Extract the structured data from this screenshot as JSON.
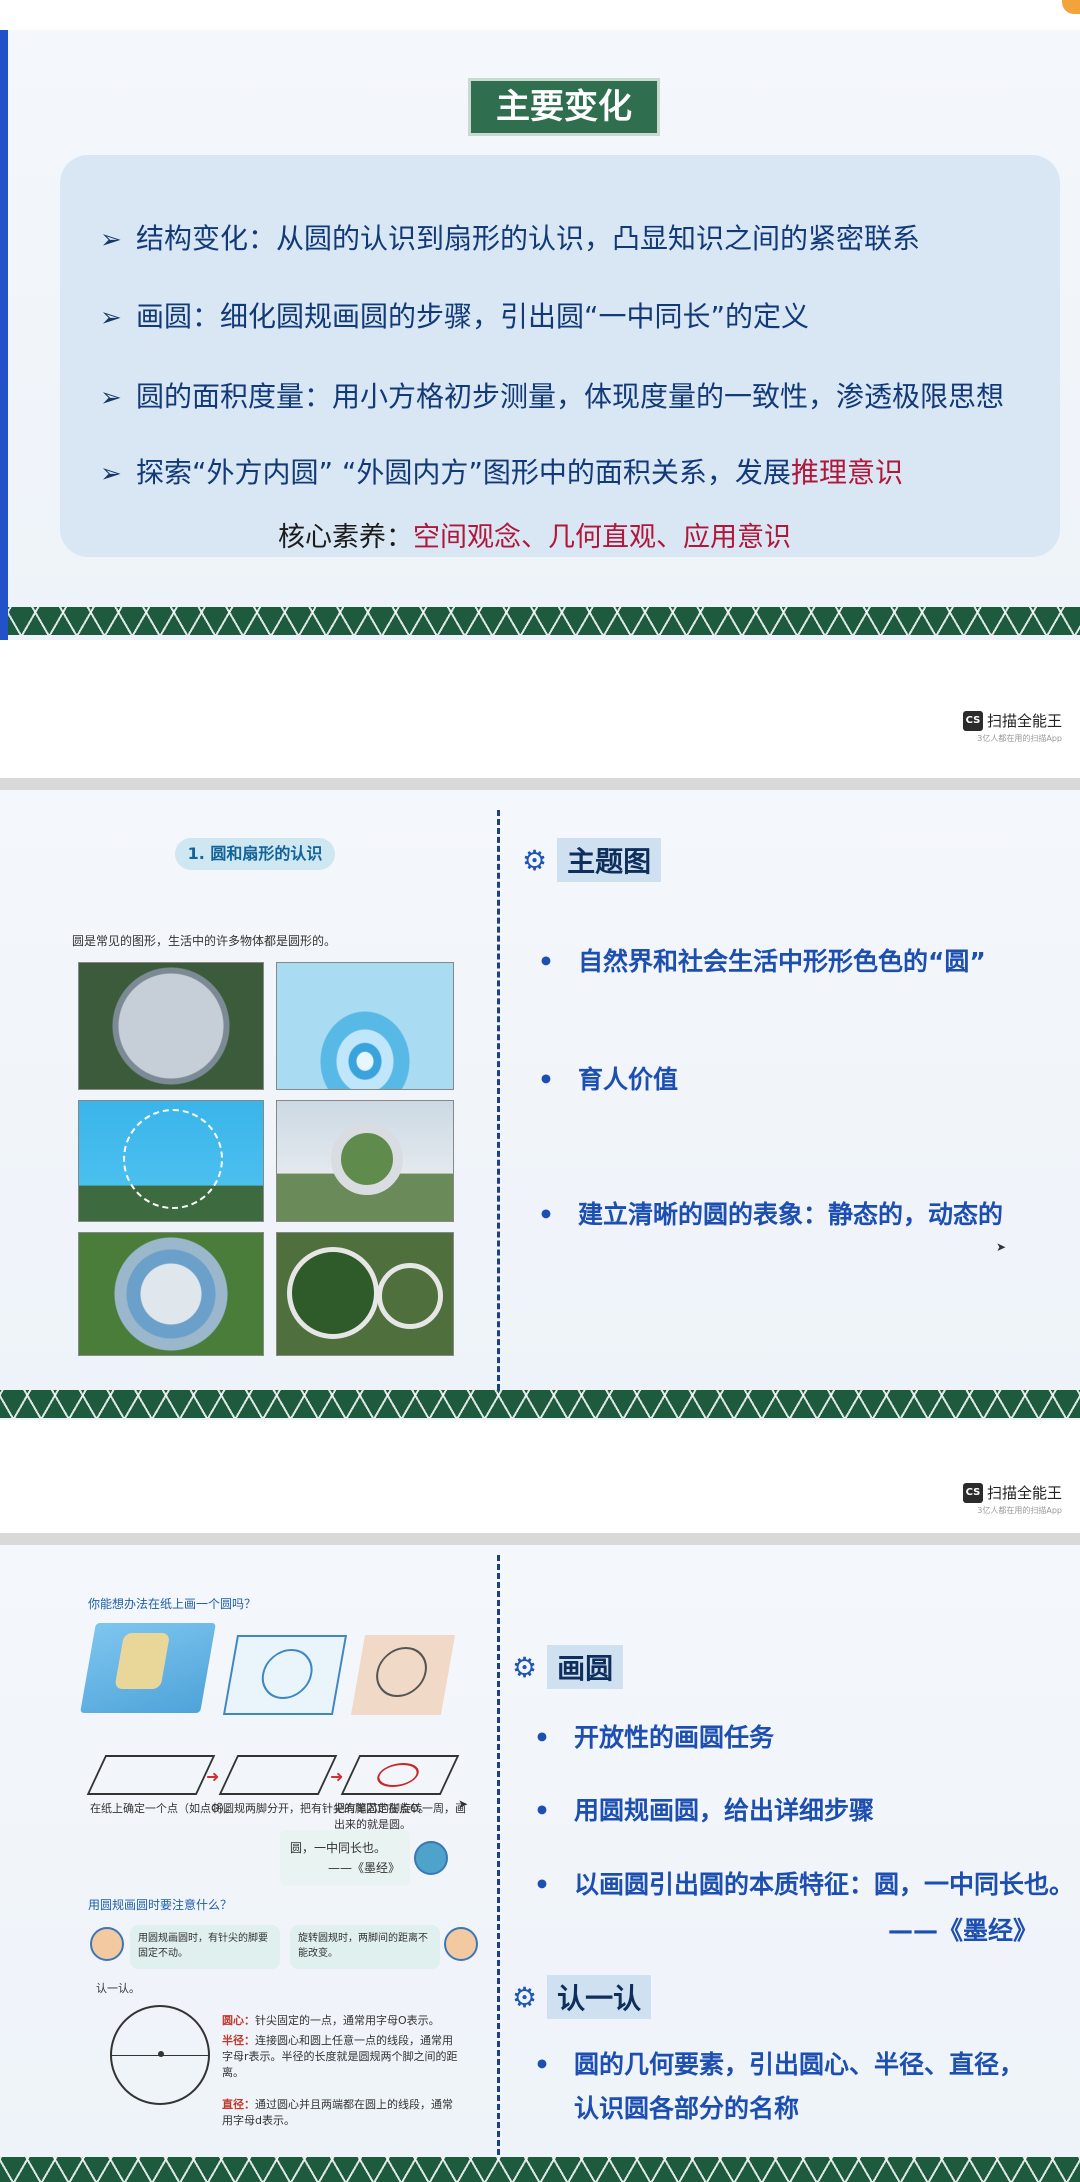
{
  "scanner": {
    "name": "扫描全能王",
    "tagline": "3亿人都在用的扫描App",
    "logo": "CS"
  },
  "slide1": {
    "title": "主要变化",
    "bullets": [
      {
        "text": "结构变化：从圆的认识到扇形的认识，凸显知识之间的紧密联系",
        "highlight": ""
      },
      {
        "text": "画圆：细化圆规画圆的步骤，引出圆“一中同长”的定义",
        "highlight": ""
      },
      {
        "text": "圆的面积度量：用小方格初步测量，体现度量的一致性，渗透极限思想",
        "highlight": ""
      },
      {
        "text": "探索“外方内圆” “外圆内方”图形中的面积关系，发展",
        "highlight": "推理意识"
      }
    ],
    "core_label": "核心素养：",
    "core_values": "空间观念、几何直观、应用意识"
  },
  "slide2": {
    "textbook_title": "1. 圆和扇形的认识",
    "textbook_caption": "圆是常见的图形，生活中的许多物体都是圆形的。",
    "section_label": "主题图",
    "items": [
      "自然界和社会生活中形形色色的“圆”",
      "育人价值",
      "建立清晰的圆的表象：静态的，动态的"
    ]
  },
  "slide3": {
    "textbook_question": "你能想办法在纸上画一个圆吗？",
    "step_texts": [
      "在纸上确定一个点（如点O）。",
      "将圆规两脚分开，把有针尖的脚固定在点O。",
      "把有笔芯的脚旋转一周，画出来的就是圆。"
    ],
    "quote": "圆，一中同长也。",
    "quote_source": "——《墨经》",
    "attention_question": "用圆规画圆时要注意什么？",
    "bubble_left": "用圆规画圆时，有针尖的脚要固定不动。",
    "bubble_right": "旋转圆规时，两脚间的距离不能改变。",
    "know_label": "认一认。",
    "def_center_term": "圆心：",
    "def_center": "针尖固定的一点，通常用字母O表示。",
    "def_radius_term": "半径：",
    "def_radius": "连接圆心和圆上任意一点的线段，通常用字母r表示。半径的长度就是圆规两个脚之间的距离。",
    "def_diameter_term": "直径：",
    "def_diameter": "通过圆心并且两端都在圆上的线段，通常用字母d表示。",
    "section1_label": "画圆",
    "items1": [
      "开放性的画圆任务",
      "用圆规画圆，给出详细步骤",
      "以画圆引出圆的本质特征：圆，一中同长也。"
    ],
    "source_line": "——《墨经》",
    "section2_label": "认一认",
    "items2_line1": "圆的几何要素，引出圆心、半径、直径，",
    "items2_line2": "认识圆各部分的名称"
  }
}
